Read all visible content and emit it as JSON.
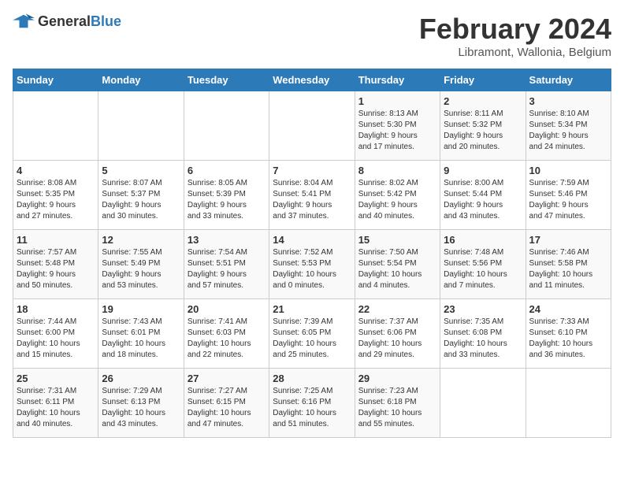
{
  "logo": {
    "general": "General",
    "blue": "Blue"
  },
  "title": "February 2024",
  "subtitle": "Libramont, Wallonia, Belgium",
  "weekdays": [
    "Sunday",
    "Monday",
    "Tuesday",
    "Wednesday",
    "Thursday",
    "Friday",
    "Saturday"
  ],
  "weeks": [
    [
      {
        "day": "",
        "info": ""
      },
      {
        "day": "",
        "info": ""
      },
      {
        "day": "",
        "info": ""
      },
      {
        "day": "",
        "info": ""
      },
      {
        "day": "1",
        "info": "Sunrise: 8:13 AM\nSunset: 5:30 PM\nDaylight: 9 hours\nand 17 minutes."
      },
      {
        "day": "2",
        "info": "Sunrise: 8:11 AM\nSunset: 5:32 PM\nDaylight: 9 hours\nand 20 minutes."
      },
      {
        "day": "3",
        "info": "Sunrise: 8:10 AM\nSunset: 5:34 PM\nDaylight: 9 hours\nand 24 minutes."
      }
    ],
    [
      {
        "day": "4",
        "info": "Sunrise: 8:08 AM\nSunset: 5:35 PM\nDaylight: 9 hours\nand 27 minutes."
      },
      {
        "day": "5",
        "info": "Sunrise: 8:07 AM\nSunset: 5:37 PM\nDaylight: 9 hours\nand 30 minutes."
      },
      {
        "day": "6",
        "info": "Sunrise: 8:05 AM\nSunset: 5:39 PM\nDaylight: 9 hours\nand 33 minutes."
      },
      {
        "day": "7",
        "info": "Sunrise: 8:04 AM\nSunset: 5:41 PM\nDaylight: 9 hours\nand 37 minutes."
      },
      {
        "day": "8",
        "info": "Sunrise: 8:02 AM\nSunset: 5:42 PM\nDaylight: 9 hours\nand 40 minutes."
      },
      {
        "day": "9",
        "info": "Sunrise: 8:00 AM\nSunset: 5:44 PM\nDaylight: 9 hours\nand 43 minutes."
      },
      {
        "day": "10",
        "info": "Sunrise: 7:59 AM\nSunset: 5:46 PM\nDaylight: 9 hours\nand 47 minutes."
      }
    ],
    [
      {
        "day": "11",
        "info": "Sunrise: 7:57 AM\nSunset: 5:48 PM\nDaylight: 9 hours\nand 50 minutes."
      },
      {
        "day": "12",
        "info": "Sunrise: 7:55 AM\nSunset: 5:49 PM\nDaylight: 9 hours\nand 53 minutes."
      },
      {
        "day": "13",
        "info": "Sunrise: 7:54 AM\nSunset: 5:51 PM\nDaylight: 9 hours\nand 57 minutes."
      },
      {
        "day": "14",
        "info": "Sunrise: 7:52 AM\nSunset: 5:53 PM\nDaylight: 10 hours\nand 0 minutes."
      },
      {
        "day": "15",
        "info": "Sunrise: 7:50 AM\nSunset: 5:54 PM\nDaylight: 10 hours\nand 4 minutes."
      },
      {
        "day": "16",
        "info": "Sunrise: 7:48 AM\nSunset: 5:56 PM\nDaylight: 10 hours\nand 7 minutes."
      },
      {
        "day": "17",
        "info": "Sunrise: 7:46 AM\nSunset: 5:58 PM\nDaylight: 10 hours\nand 11 minutes."
      }
    ],
    [
      {
        "day": "18",
        "info": "Sunrise: 7:44 AM\nSunset: 6:00 PM\nDaylight: 10 hours\nand 15 minutes."
      },
      {
        "day": "19",
        "info": "Sunrise: 7:43 AM\nSunset: 6:01 PM\nDaylight: 10 hours\nand 18 minutes."
      },
      {
        "day": "20",
        "info": "Sunrise: 7:41 AM\nSunset: 6:03 PM\nDaylight: 10 hours\nand 22 minutes."
      },
      {
        "day": "21",
        "info": "Sunrise: 7:39 AM\nSunset: 6:05 PM\nDaylight: 10 hours\nand 25 minutes."
      },
      {
        "day": "22",
        "info": "Sunrise: 7:37 AM\nSunset: 6:06 PM\nDaylight: 10 hours\nand 29 minutes."
      },
      {
        "day": "23",
        "info": "Sunrise: 7:35 AM\nSunset: 6:08 PM\nDaylight: 10 hours\nand 33 minutes."
      },
      {
        "day": "24",
        "info": "Sunrise: 7:33 AM\nSunset: 6:10 PM\nDaylight: 10 hours\nand 36 minutes."
      }
    ],
    [
      {
        "day": "25",
        "info": "Sunrise: 7:31 AM\nSunset: 6:11 PM\nDaylight: 10 hours\nand 40 minutes."
      },
      {
        "day": "26",
        "info": "Sunrise: 7:29 AM\nSunset: 6:13 PM\nDaylight: 10 hours\nand 43 minutes."
      },
      {
        "day": "27",
        "info": "Sunrise: 7:27 AM\nSunset: 6:15 PM\nDaylight: 10 hours\nand 47 minutes."
      },
      {
        "day": "28",
        "info": "Sunrise: 7:25 AM\nSunset: 6:16 PM\nDaylight: 10 hours\nand 51 minutes."
      },
      {
        "day": "29",
        "info": "Sunrise: 7:23 AM\nSunset: 6:18 PM\nDaylight: 10 hours\nand 55 minutes."
      },
      {
        "day": "",
        "info": ""
      },
      {
        "day": "",
        "info": ""
      }
    ]
  ]
}
